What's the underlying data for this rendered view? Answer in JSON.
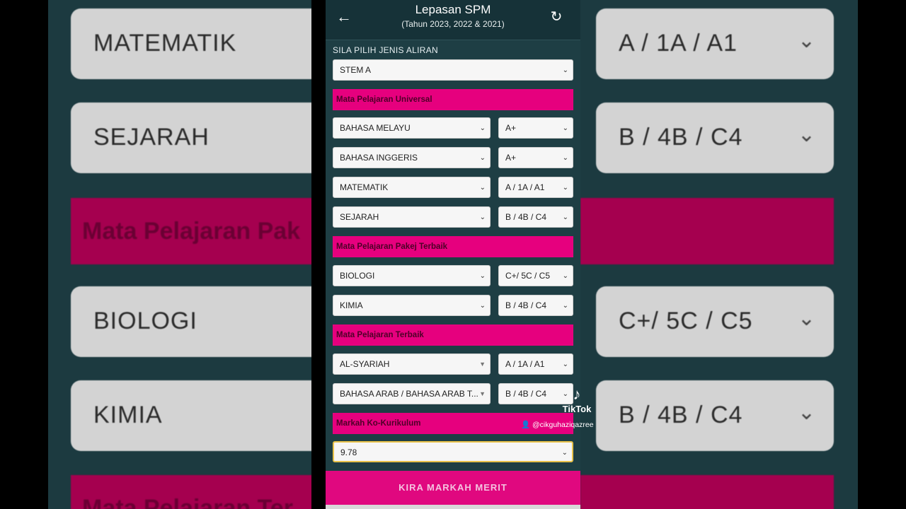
{
  "background": {
    "left_boxes": [
      "MATEMATIK",
      "SEJARAH",
      "BIOLOGI",
      "KIMIA"
    ],
    "left_pink": [
      "Mata Pelajaran Pak",
      "Mata Pelajaran Ter"
    ],
    "right_boxes": [
      "A / 1A / A1",
      "B / 4B / C4",
      "C+/ 5C / C5",
      "B / 4B / C4"
    ]
  },
  "header": {
    "title": "Lepasan SPM",
    "subtitle": "(Tahun 2023, 2022 & 2021)",
    "back_icon": "←",
    "refresh_icon": "↻"
  },
  "stream": {
    "label": "SILA PILIH JENIS ALIRAN",
    "value": "STEM A"
  },
  "sections": {
    "universal": "Mata Pelajaran Universal",
    "pakej": "Mata Pelajaran Pakej Terbaik",
    "terbaik": "Mata Pelajaran Terbaik",
    "kokurikulum": "Markah Ko-Kurikulum"
  },
  "universal_subjects": [
    {
      "subject": "BAHASA MELAYU",
      "grade": "A+"
    },
    {
      "subject": "BAHASA INGGERIS",
      "grade": "A+"
    },
    {
      "subject": "MATEMATIK",
      "grade": "A / 1A / A1"
    },
    {
      "subject": "SEJARAH",
      "grade": "B / 4B / C4"
    }
  ],
  "pakej_subjects": [
    {
      "subject": "BIOLOGI",
      "grade": "C+/ 5C / C5"
    },
    {
      "subject": "KIMIA",
      "grade": "B / 4B / C4"
    }
  ],
  "terbaik_subjects": [
    {
      "subject": "AL-SYARIAH",
      "grade": "A / 1A / A1"
    },
    {
      "subject": "BAHASA ARAB / BAHASA ARAB T...",
      "grade": "B / 4B / C4"
    }
  ],
  "kokurikulum_value": "9.78",
  "submit_label": "KIRA MARKAH MERIT",
  "watermark": {
    "brand": "TikTok",
    "handle": "@cikguhaziqazree"
  }
}
